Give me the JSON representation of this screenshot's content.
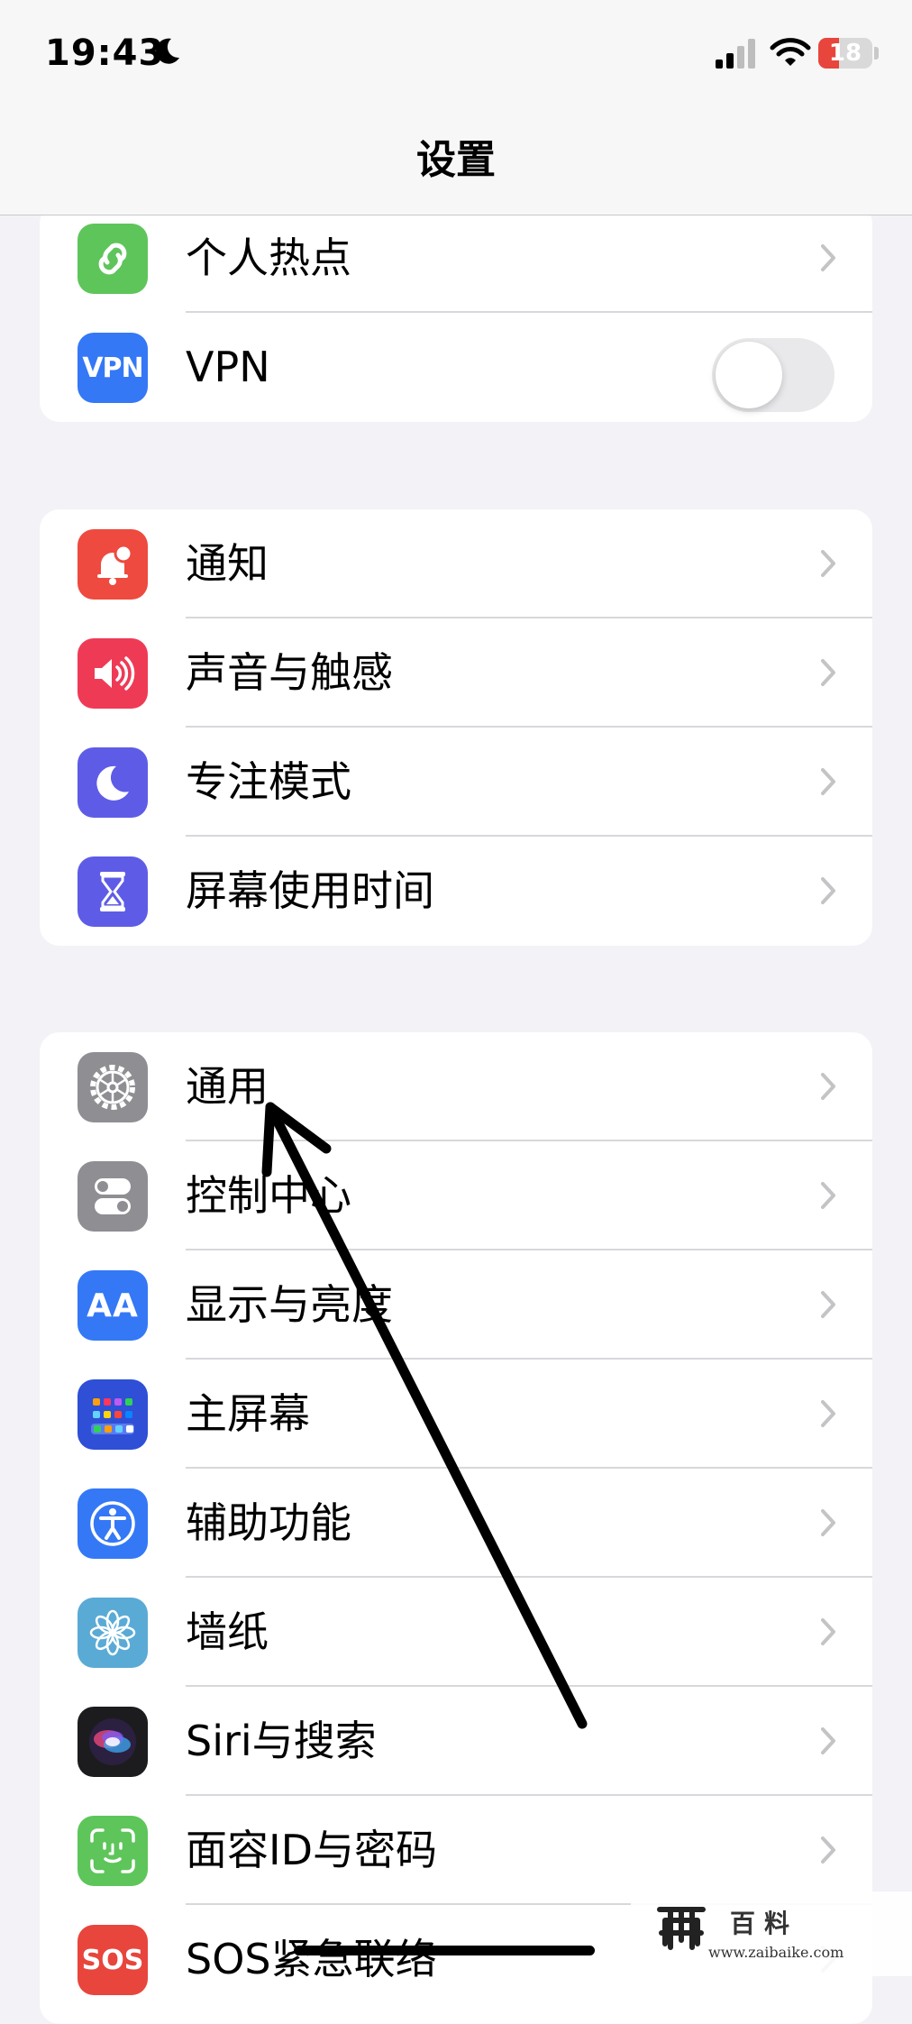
{
  "status_bar": {
    "time": "19:43",
    "battery_level": "18",
    "battery_fraction": 0.18,
    "battery_color": "#e8453c",
    "icons": [
      "moon-icon",
      "cellular-signal-icon",
      "wifi-icon",
      "battery-icon"
    ]
  },
  "nav": {
    "title": "设置"
  },
  "groups": [
    {
      "items": [
        {
          "label": "个人热点",
          "icon": "personal-hotspot-icon",
          "color": "#5ec55a",
          "accessory": "chevron"
        },
        {
          "label": "VPN",
          "icon": "vpn-icon",
          "icon_text": "VPN",
          "color": "#3478f6",
          "accessory": "toggle",
          "toggle_on": false
        }
      ]
    },
    {
      "items": [
        {
          "label": "通知",
          "icon": "notifications-icon",
          "color": "#ee4a3f",
          "accessory": "chevron"
        },
        {
          "label": "声音与触感",
          "icon": "sounds-haptics-icon",
          "color": "#ef3a56",
          "accessory": "chevron"
        },
        {
          "label": "专注模式",
          "icon": "focus-moon-icon",
          "color": "#5e5ce6",
          "accessory": "chevron"
        },
        {
          "label": "屏幕使用时间",
          "icon": "screen-time-hourglass-icon",
          "color": "#5e5ce6",
          "accessory": "chevron"
        }
      ]
    },
    {
      "items": [
        {
          "label": "通用",
          "icon": "general-gear-icon",
          "color": "#8e8e93",
          "accessory": "chevron"
        },
        {
          "label": "控制中心",
          "icon": "control-center-icon",
          "color": "#8e8e93",
          "accessory": "chevron"
        },
        {
          "label": "显示与亮度",
          "icon": "display-brightness-icon",
          "icon_text": "AA",
          "color": "#3478f6",
          "accessory": "chevron"
        },
        {
          "label": "主屏幕",
          "icon": "home-screen-icon",
          "color": "#2e4fd6",
          "accessory": "chevron"
        },
        {
          "label": "辅助功能",
          "icon": "accessibility-icon",
          "color": "#3478f6",
          "accessory": "chevron"
        },
        {
          "label": "墙纸",
          "icon": "wallpaper-flower-icon",
          "color": "#5aaad6",
          "accessory": "chevron"
        },
        {
          "label": "Siri与搜索",
          "icon": "siri-icon",
          "color": "#1c1c1e",
          "accessory": "chevron"
        },
        {
          "label": "面容ID与密码",
          "icon": "face-id-icon",
          "color": "#5ec55a",
          "accessory": "chevron"
        },
        {
          "label": "SOS紧急联络",
          "icon": "emergency-sos-icon",
          "icon_text": "SOS",
          "color": "#e8453c",
          "accessory": "chevron"
        }
      ]
    }
  ],
  "overlay": {
    "annotation": "arrow-pointing-to-general"
  },
  "watermark": {
    "title": "百料",
    "url": "www.zaibaike.com"
  }
}
